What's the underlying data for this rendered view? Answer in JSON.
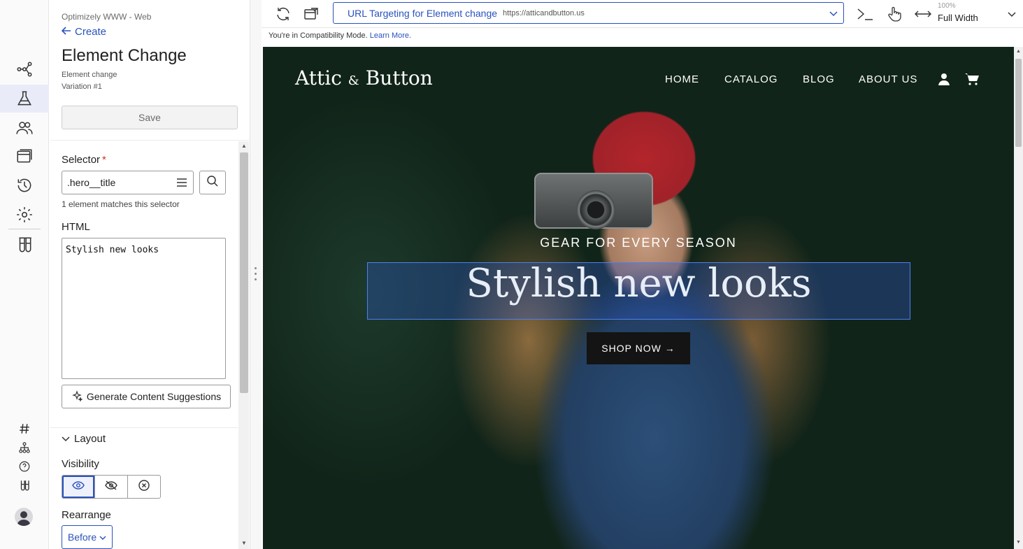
{
  "rail": {
    "items": [
      {
        "name": "flow-icon"
      },
      {
        "name": "flask-icon",
        "active": true
      },
      {
        "name": "audiences-icon"
      },
      {
        "name": "pages-icon"
      },
      {
        "name": "history-icon"
      },
      {
        "name": "settings-icon"
      },
      {
        "name": "test-tubes-icon"
      }
    ],
    "bottom": [
      {
        "name": "hash-icon"
      },
      {
        "name": "hierarchy-icon"
      },
      {
        "name": "help-icon"
      },
      {
        "name": "test-tubes-small-icon"
      }
    ]
  },
  "panel": {
    "project": "Optimizely WWW - Web",
    "back_label": "Create",
    "title": "Element Change",
    "subtitle": "Element change",
    "variation": "Variation #1",
    "save_label": "Save",
    "selector_label": "Selector",
    "required_mark": "*",
    "selector_value": ".hero__title",
    "match_text": "1 element matches this selector",
    "html_label": "HTML",
    "html_value": "Stylish new looks",
    "generate_label": "Generate Content Suggestions",
    "layout_label": "Layout",
    "visibility_label": "Visibility",
    "visibility_options": [
      "visible",
      "hidden",
      "removed"
    ],
    "visibility_selected": "visible",
    "rearrange_label": "Rearrange",
    "rearrange_value": "Before"
  },
  "toolbar": {
    "url_name": "URL Targeting for Element change",
    "url_address": "https://atticandbutton.us",
    "zoom_percent": "100%",
    "zoom_mode": "Full Width",
    "compat_text": "You're in Compatibility Mode.",
    "compat_link": "Learn More."
  },
  "preview": {
    "logo_main": "Attic",
    "logo_amp": "&",
    "logo_end": "Button",
    "nav": [
      "HOME",
      "CATALOG",
      "BLOG",
      "ABOUT US"
    ],
    "kicker": "GEAR FOR EVERY SEASON",
    "hero_title": "Stylish new looks",
    "shop_label": "SHOP NOW →"
  },
  "colors": {
    "accent": "#2a52be",
    "required": "#d0312d",
    "selection_overlay": "#4f7ff0"
  }
}
